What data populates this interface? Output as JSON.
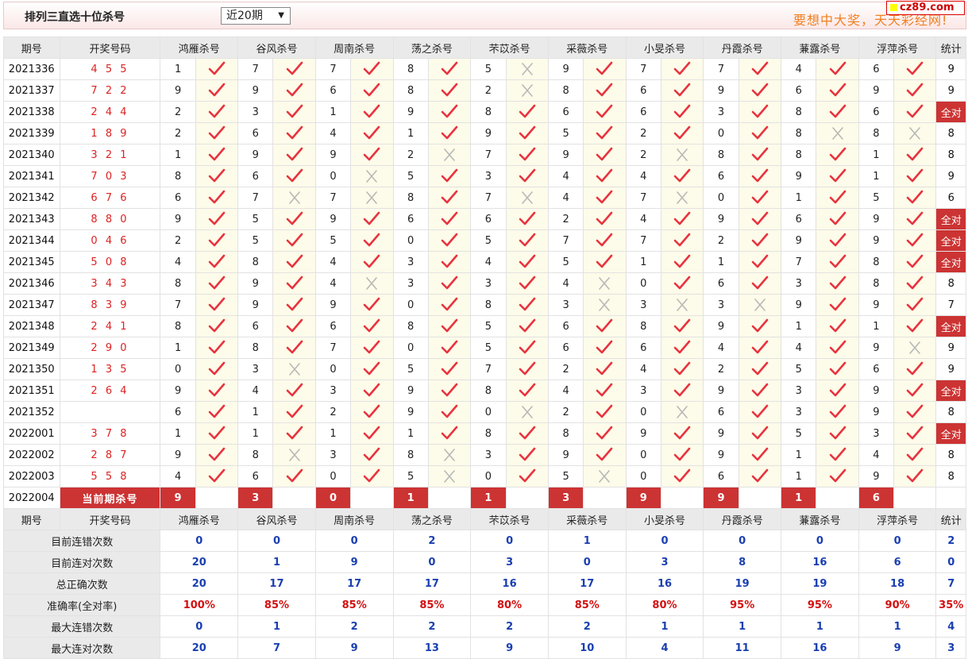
{
  "header": {
    "title": "排列三直选十位杀号",
    "period_select": "近20期",
    "slogan": "要想中大奖，天天彩经网!",
    "logo_text": "cz89.com"
  },
  "columns": {
    "issue": "期号",
    "draw": "开奖号码",
    "experts": [
      "鸿雁杀号",
      "谷风杀号",
      "周南杀号",
      "荡之杀号",
      "芣苡杀号",
      "采薇杀号",
      "小旻杀号",
      "丹霞杀号",
      "蒹露杀号",
      "浮萍杀号"
    ],
    "stat": "统计"
  },
  "rows": [
    {
      "issue": "2021336",
      "draw": "4 5 5",
      "kills": [
        1,
        7,
        7,
        8,
        5,
        9,
        7,
        7,
        4,
        6
      ],
      "hits": [
        1,
        1,
        1,
        1,
        0,
        1,
        1,
        1,
        1,
        1
      ],
      "stat": "9"
    },
    {
      "issue": "2021337",
      "draw": "7 2 2",
      "kills": [
        9,
        9,
        6,
        8,
        2,
        8,
        6,
        9,
        6,
        9
      ],
      "hits": [
        1,
        1,
        1,
        1,
        0,
        1,
        1,
        1,
        1,
        1
      ],
      "stat": "9"
    },
    {
      "issue": "2021338",
      "draw": "2 4 4",
      "kills": [
        2,
        3,
        1,
        9,
        8,
        6,
        6,
        3,
        8,
        6
      ],
      "hits": [
        1,
        1,
        1,
        1,
        1,
        1,
        1,
        1,
        1,
        1
      ],
      "stat": "全对"
    },
    {
      "issue": "2021339",
      "draw": "1 8 9",
      "kills": [
        2,
        6,
        4,
        1,
        9,
        5,
        2,
        0,
        8,
        8
      ],
      "hits": [
        1,
        1,
        1,
        1,
        1,
        1,
        1,
        1,
        0,
        0
      ],
      "stat": "8"
    },
    {
      "issue": "2021340",
      "draw": "3 2 1",
      "kills": [
        1,
        9,
        9,
        2,
        7,
        9,
        2,
        8,
        8,
        1
      ],
      "hits": [
        1,
        1,
        1,
        0,
        1,
        1,
        0,
        1,
        1,
        1
      ],
      "stat": "8"
    },
    {
      "issue": "2021341",
      "draw": "7 0 3",
      "kills": [
        8,
        6,
        0,
        5,
        3,
        4,
        4,
        6,
        9,
        1
      ],
      "hits": [
        1,
        1,
        0,
        1,
        1,
        1,
        1,
        1,
        1,
        1
      ],
      "stat": "9"
    },
    {
      "issue": "2021342",
      "draw": "6 7 6",
      "kills": [
        6,
        7,
        7,
        8,
        7,
        4,
        7,
        0,
        1,
        5
      ],
      "hits": [
        1,
        0,
        0,
        1,
        0,
        1,
        0,
        1,
        1,
        1
      ],
      "stat": "6"
    },
    {
      "issue": "2021343",
      "draw": "8 8 0",
      "kills": [
        9,
        5,
        9,
        6,
        6,
        2,
        4,
        9,
        6,
        9
      ],
      "hits": [
        1,
        1,
        1,
        1,
        1,
        1,
        1,
        1,
        1,
        1
      ],
      "stat": "全对"
    },
    {
      "issue": "2021344",
      "draw": "0 4 6",
      "kills": [
        2,
        5,
        5,
        0,
        5,
        7,
        7,
        2,
        9,
        9
      ],
      "hits": [
        1,
        1,
        1,
        1,
        1,
        1,
        1,
        1,
        1,
        1
      ],
      "stat": "全对"
    },
    {
      "issue": "2021345",
      "draw": "5 0 8",
      "kills": [
        4,
        8,
        4,
        3,
        4,
        5,
        1,
        1,
        7,
        8
      ],
      "hits": [
        1,
        1,
        1,
        1,
        1,
        1,
        1,
        1,
        1,
        1
      ],
      "stat": "全对"
    },
    {
      "issue": "2021346",
      "draw": "3 4 3",
      "kills": [
        8,
        9,
        4,
        3,
        3,
        4,
        0,
        6,
        3,
        8
      ],
      "hits": [
        1,
        1,
        0,
        1,
        1,
        0,
        1,
        1,
        1,
        1
      ],
      "stat": "8"
    },
    {
      "issue": "2021347",
      "draw": "8 3 9",
      "kills": [
        7,
        9,
        9,
        0,
        8,
        3,
        3,
        3,
        9,
        9
      ],
      "hits": [
        1,
        1,
        1,
        1,
        1,
        0,
        0,
        0,
        1,
        1
      ],
      "stat": "7"
    },
    {
      "issue": "2021348",
      "draw": "2 4 1",
      "kills": [
        8,
        6,
        6,
        8,
        5,
        6,
        8,
        9,
        1,
        1
      ],
      "hits": [
        1,
        1,
        1,
        1,
        1,
        1,
        1,
        1,
        1,
        1
      ],
      "stat": "全对"
    },
    {
      "issue": "2021349",
      "draw": "2 9 0",
      "kills": [
        1,
        8,
        7,
        0,
        5,
        6,
        6,
        4,
        4,
        9
      ],
      "hits": [
        1,
        1,
        1,
        1,
        1,
        1,
        1,
        1,
        1,
        0
      ],
      "stat": "9"
    },
    {
      "issue": "2021350",
      "draw": "1 3 5",
      "kills": [
        0,
        3,
        0,
        5,
        7,
        2,
        4,
        2,
        5,
        6
      ],
      "hits": [
        1,
        0,
        1,
        1,
        1,
        1,
        1,
        1,
        1,
        1
      ],
      "stat": "9"
    },
    {
      "issue": "2021351",
      "draw": "2 6 4",
      "kills": [
        9,
        4,
        3,
        9,
        8,
        4,
        3,
        9,
        3,
        9
      ],
      "hits": [
        1,
        1,
        1,
        1,
        1,
        1,
        1,
        1,
        1,
        1
      ],
      "stat": "全对"
    },
    {
      "issue": "2021352",
      "draw": "",
      "kills": [
        6,
        1,
        2,
        9,
        0,
        2,
        0,
        6,
        3,
        9
      ],
      "hits": [
        1,
        1,
        1,
        1,
        0,
        1,
        0,
        1,
        1,
        1
      ],
      "stat": "8"
    },
    {
      "issue": "2022001",
      "draw": "3 7 8",
      "kills": [
        1,
        1,
        1,
        1,
        8,
        8,
        9,
        9,
        5,
        3
      ],
      "hits": [
        1,
        1,
        1,
        1,
        1,
        1,
        1,
        1,
        1,
        1
      ],
      "stat": "全对"
    },
    {
      "issue": "2022002",
      "draw": "2 8 7",
      "kills": [
        9,
        8,
        3,
        8,
        3,
        9,
        0,
        9,
        1,
        4
      ],
      "hits": [
        1,
        0,
        1,
        0,
        1,
        1,
        1,
        1,
        1,
        1
      ],
      "stat": "8"
    },
    {
      "issue": "2022003",
      "draw": "5 5 8",
      "kills": [
        4,
        6,
        0,
        5,
        0,
        5,
        0,
        6,
        1,
        9
      ],
      "hits": [
        1,
        1,
        1,
        0,
        1,
        0,
        1,
        1,
        1,
        1
      ],
      "stat": "8"
    }
  ],
  "current": {
    "issue": "2022004",
    "label": "当前期杀号",
    "kills": [
      9,
      3,
      0,
      1,
      1,
      3,
      9,
      9,
      1,
      6
    ]
  },
  "summary": [
    {
      "label": "目前连错次数",
      "values": [
        "0",
        "0",
        "0",
        "2",
        "0",
        "1",
        "0",
        "0",
        "0",
        "0"
      ],
      "stat": "2",
      "red": false
    },
    {
      "label": "目前连对次数",
      "values": [
        "20",
        "1",
        "9",
        "0",
        "3",
        "0",
        "3",
        "8",
        "16",
        "6"
      ],
      "stat": "0",
      "red": false
    },
    {
      "label": "总正确次数",
      "values": [
        "20",
        "17",
        "17",
        "17",
        "16",
        "17",
        "16",
        "19",
        "19",
        "18"
      ],
      "stat": "7",
      "red": false
    },
    {
      "label": "准确率(全对率)",
      "values": [
        "100%",
        "85%",
        "85%",
        "85%",
        "80%",
        "85%",
        "80%",
        "95%",
        "95%",
        "90%"
      ],
      "stat": "35%",
      "red": true
    },
    {
      "label": "最大连错次数",
      "values": [
        "0",
        "1",
        "2",
        "2",
        "2",
        "2",
        "1",
        "1",
        "1",
        "1"
      ],
      "stat": "4",
      "red": false
    },
    {
      "label": "最大连对次数",
      "values": [
        "20",
        "7",
        "9",
        "13",
        "9",
        "10",
        "4",
        "11",
        "16",
        "9"
      ],
      "stat": "3",
      "red": false
    }
  ],
  "colors": {
    "hit": "#e8333f",
    "miss": "#b8b8b8",
    "accent": "#cc3333",
    "summary_value": "#1a3fb0",
    "slogan": "#f08020"
  },
  "icons": {
    "hit": "check-icon",
    "miss": "cross-icon"
  }
}
